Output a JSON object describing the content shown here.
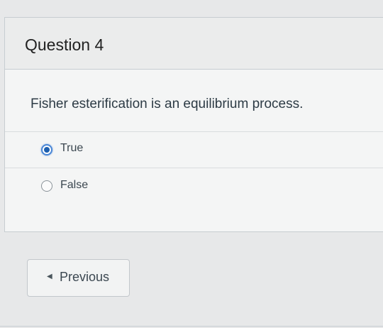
{
  "question": {
    "title": "Question 4",
    "text": "Fisher esterification is an equilibrium process.",
    "answers": [
      {
        "label": "True",
        "selected": true
      },
      {
        "label": "False",
        "selected": false
      }
    ]
  },
  "navigation": {
    "previous_label": "Previous",
    "previous_icon": "chevron-left-icon"
  },
  "colors": {
    "page_background": "#e7e8e9",
    "selected_radio": "#1d5fae",
    "text": "#2d3b45"
  }
}
